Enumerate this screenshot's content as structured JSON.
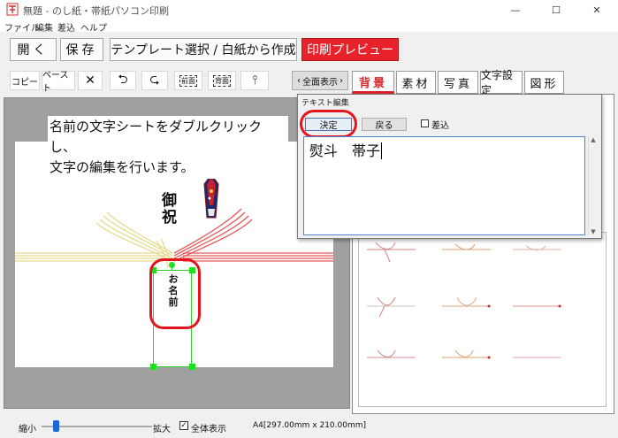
{
  "window": {
    "title": "無題 - のし紙・帯紙パソコン印刷",
    "controls": {
      "minimize": "—",
      "maximize": "☐",
      "close": "✕"
    }
  },
  "menu": [
    "ファイル",
    "編集",
    "差込",
    "ヘルプ"
  ],
  "toolbar": {
    "open": "開く",
    "save": "保存",
    "template": "テンプレート選択 / 白紙から作成",
    "print_preview": "印刷プレビュー"
  },
  "edit_toolbar": {
    "copy": "コピー",
    "paste": "ペースト",
    "delete": "✕",
    "undo": "⮌",
    "redo": "⮎",
    "front": "前面",
    "back": "背面",
    "tree": "⫯"
  },
  "full_view_button": "全面表示",
  "tabs": [
    "背景",
    "素材",
    "写真",
    "文字設定",
    "図形"
  ],
  "canvas": {
    "instruction_line1": "名前の文字シートをダブルクリックし、",
    "instruction_line2": "文字の編集を行います。",
    "kotobuki": "御祝",
    "name_placeholder": "お名前"
  },
  "dialog": {
    "title": "テキスト編集",
    "confirm": "決定",
    "back": "戻る",
    "insert_label": "差込",
    "insert_checked": false,
    "text_value": "熨斗　帯子"
  },
  "status": {
    "zoom_out": "縮小",
    "zoom_in": "拡大",
    "fullview_label": "全体表示",
    "fullview_checked": true,
    "paper_size": "A4[297.00mm x 210.00mm]"
  },
  "colors": {
    "accent_red": "#e8222a",
    "mizuhiki_gold": "#e6d98a",
    "mizuhiki_red": "#e35b5b",
    "selection_green": "#22d822"
  }
}
